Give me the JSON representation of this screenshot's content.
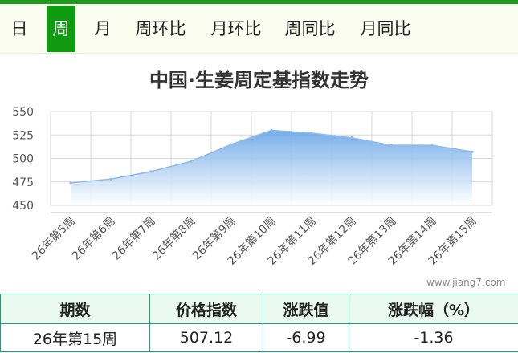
{
  "tabs": [
    {
      "label": "日",
      "active": false
    },
    {
      "label": "周",
      "active": true
    },
    {
      "label": "月",
      "active": false
    },
    {
      "label": "周环比",
      "active": false
    },
    {
      "label": "月环比",
      "active": false
    },
    {
      "label": "周同比",
      "active": false
    },
    {
      "label": "月同比",
      "active": false
    }
  ],
  "watermark": "www.jiang7.com",
  "colors": {
    "accent": "#109a10",
    "line": "#8fbce8",
    "fill_top": "#6fa8e8",
    "table_border": "#1aa07a"
  },
  "chart_data": {
    "type": "area",
    "title": "中国·生姜周定基指数走势",
    "categories": [
      "26年第5周",
      "26年第6周",
      "26年第7周",
      "26年第8周",
      "26年第9周",
      "26年第10周",
      "26年第11周",
      "26年第12周",
      "26年第13周",
      "26年第14周",
      "26年第15周"
    ],
    "values": [
      474,
      478,
      486,
      497,
      515,
      530,
      527,
      522,
      514,
      514,
      507.12
    ],
    "ylim": [
      450,
      550
    ],
    "yticks": [
      450,
      475,
      500,
      525,
      550
    ],
    "xlabel": "",
    "ylabel": "",
    "grid": true
  },
  "table": {
    "headers": [
      "期数",
      "价格指数",
      "涨跌值",
      "涨跌幅（%）"
    ],
    "rows": [
      [
        "26年第15周",
        "507.12",
        "-6.99",
        "-1.36"
      ]
    ]
  }
}
